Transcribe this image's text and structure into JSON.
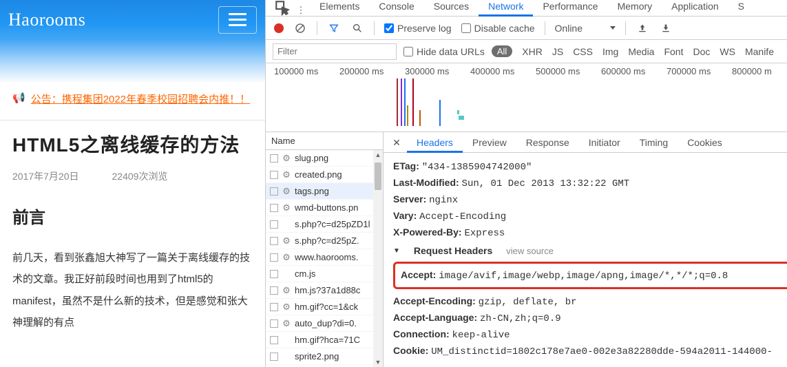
{
  "site": {
    "title": "Haorooms",
    "notice_prefix": "公告：",
    "notice_text": "携程集团2022年春季校园招聘会内推！！",
    "article_title": "HTML5之离线缓存的方法",
    "article_date": "2017年7月20日",
    "article_views": "22409次浏览",
    "article_h2": "前言",
    "article_p": "前几天，看到张鑫旭大神写了一篇关于离线缓存的技术的文章。我正好前段时间也用到了html5的manifest，虽然不是什么新的技术，但是感觉和张大神理解的有点"
  },
  "devtools": {
    "tabs": [
      "Elements",
      "Console",
      "Sources",
      "Network",
      "Performance",
      "Memory",
      "Application",
      "S"
    ],
    "active_tab": "Network",
    "preserve_log": "Preserve log",
    "disable_cache": "Disable cache",
    "online": "Online",
    "filter_placeholder": "Filter",
    "hide_data_urls": "Hide data URLs",
    "filter_types": [
      "All",
      "XHR",
      "JS",
      "CSS",
      "Img",
      "Media",
      "Font",
      "Doc",
      "WS",
      "Manife"
    ],
    "timeline_labels": [
      "100000 ms",
      "200000 ms",
      "300000 ms",
      "400000 ms",
      "500000 ms",
      "600000 ms",
      "700000 ms",
      "800000 m"
    ],
    "name_header": "Name",
    "requests": [
      {
        "name": "slug.png",
        "icon": "cog",
        "sel": false
      },
      {
        "name": "created.png",
        "icon": "cog",
        "sel": false
      },
      {
        "name": "tags.png",
        "icon": "cog",
        "sel": true
      },
      {
        "name": "wmd-buttons.pn",
        "icon": "cog",
        "sel": false
      },
      {
        "name": "s.php?c=d25pZD1l",
        "icon": "none",
        "sel": false
      },
      {
        "name": "s.php?c=d25pZ.",
        "icon": "cog",
        "sel": false
      },
      {
        "name": "www.haorooms.",
        "icon": "cog",
        "sel": false
      },
      {
        "name": "cm.js",
        "icon": "none",
        "sel": false
      },
      {
        "name": "hm.js?37a1d88c",
        "icon": "cog",
        "sel": false
      },
      {
        "name": "hm.gif?cc=1&ck",
        "icon": "cog",
        "sel": false
      },
      {
        "name": "auto_dup?di=0.",
        "icon": "cog",
        "sel": false
      },
      {
        "name": "hm.gif?hca=71C",
        "icon": "none",
        "sel": false
      },
      {
        "name": "sprite2.png",
        "icon": "none",
        "sel": false
      }
    ],
    "detail_tabs": [
      "Headers",
      "Preview",
      "Response",
      "Initiator",
      "Timing",
      "Cookies"
    ],
    "active_detail_tab": "Headers",
    "response_headers": [
      {
        "k": "ETag:",
        "v": "\"434-1385904742000\""
      },
      {
        "k": "Last-Modified:",
        "v": "Sun, 01 Dec 2013 13:32:22 GMT"
      },
      {
        "k": "Server:",
        "v": "nginx"
      },
      {
        "k": "Vary:",
        "v": "Accept-Encoding"
      },
      {
        "k": "X-Powered-By:",
        "v": "Express"
      }
    ],
    "request_headers_title": "Request Headers",
    "view_source": "view source",
    "request_headers": [
      {
        "k": "Accept:",
        "v": "image/avif,image/webp,image/apng,image/*,*/*;q=0.8",
        "hl": true
      },
      {
        "k": "Accept-Encoding:",
        "v": "gzip, deflate, br"
      },
      {
        "k": "Accept-Language:",
        "v": "zh-CN,zh;q=0.9"
      },
      {
        "k": "Connection:",
        "v": "keep-alive"
      },
      {
        "k": "Cookie:",
        "v": "UM_distinctid=1802c178e7ae0-002e3a82280dde-594a2011-144000-"
      }
    ]
  }
}
